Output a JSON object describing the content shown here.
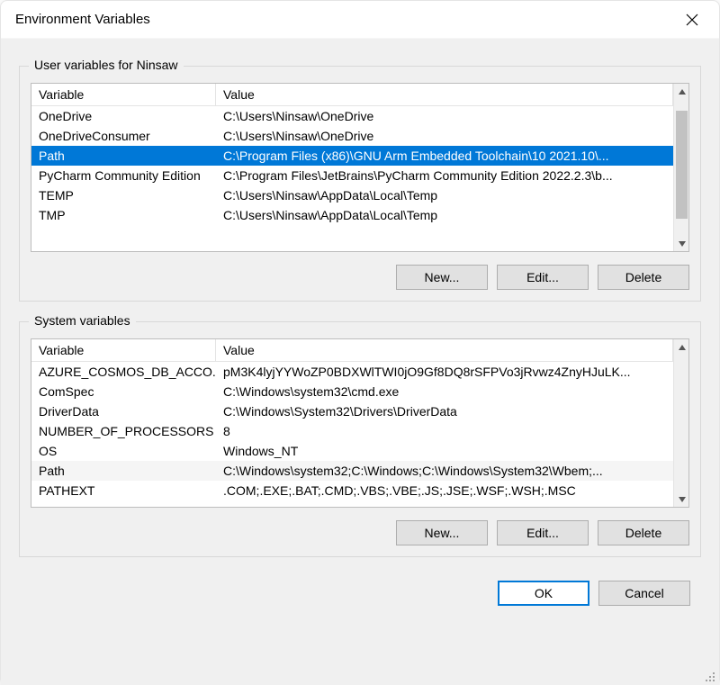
{
  "title": "Environment Variables",
  "columns": {
    "variable": "Variable",
    "value": "Value"
  },
  "buttons": {
    "new": "New...",
    "edit": "Edit...",
    "delete": "Delete",
    "ok": "OK",
    "cancel": "Cancel"
  },
  "user_group": {
    "legend": "User variables for Ninsaw",
    "selected_index": 2,
    "rows": [
      {
        "variable": "OneDrive",
        "value": "C:\\Users\\Ninsaw\\OneDrive"
      },
      {
        "variable": "OneDriveConsumer",
        "value": "C:\\Users\\Ninsaw\\OneDrive"
      },
      {
        "variable": "Path",
        "value": "C:\\Program Files (x86)\\GNU Arm Embedded Toolchain\\10 2021.10\\..."
      },
      {
        "variable": "PyCharm Community Edition",
        "value": "C:\\Program Files\\JetBrains\\PyCharm Community Edition 2022.2.3\\b..."
      },
      {
        "variable": "TEMP",
        "value": "C:\\Users\\Ninsaw\\AppData\\Local\\Temp"
      },
      {
        "variable": "TMP",
        "value": "C:\\Users\\Ninsaw\\AppData\\Local\\Temp"
      }
    ]
  },
  "system_group": {
    "legend": "System variables",
    "selected_index": -1,
    "rows": [
      {
        "variable": "AZURE_COSMOS_DB_ACCO...",
        "value": "pM3K4lyjYYWoZP0BDXWlTWI0jO9Gf8DQ8rSFPVo3jRvwz4ZnyHJuLK..."
      },
      {
        "variable": "ComSpec",
        "value": "C:\\Windows\\system32\\cmd.exe"
      },
      {
        "variable": "DriverData",
        "value": "C:\\Windows\\System32\\Drivers\\DriverData"
      },
      {
        "variable": "NUMBER_OF_PROCESSORS",
        "value": "8"
      },
      {
        "variable": "OS",
        "value": "Windows_NT"
      },
      {
        "variable": "Path",
        "value": "C:\\Windows\\system32;C:\\Windows;C:\\Windows\\System32\\Wbem;..."
      },
      {
        "variable": "PATHEXT",
        "value": ".COM;.EXE;.BAT;.CMD;.VBS;.VBE;.JS;.JSE;.WSF;.WSH;.MSC"
      }
    ]
  }
}
